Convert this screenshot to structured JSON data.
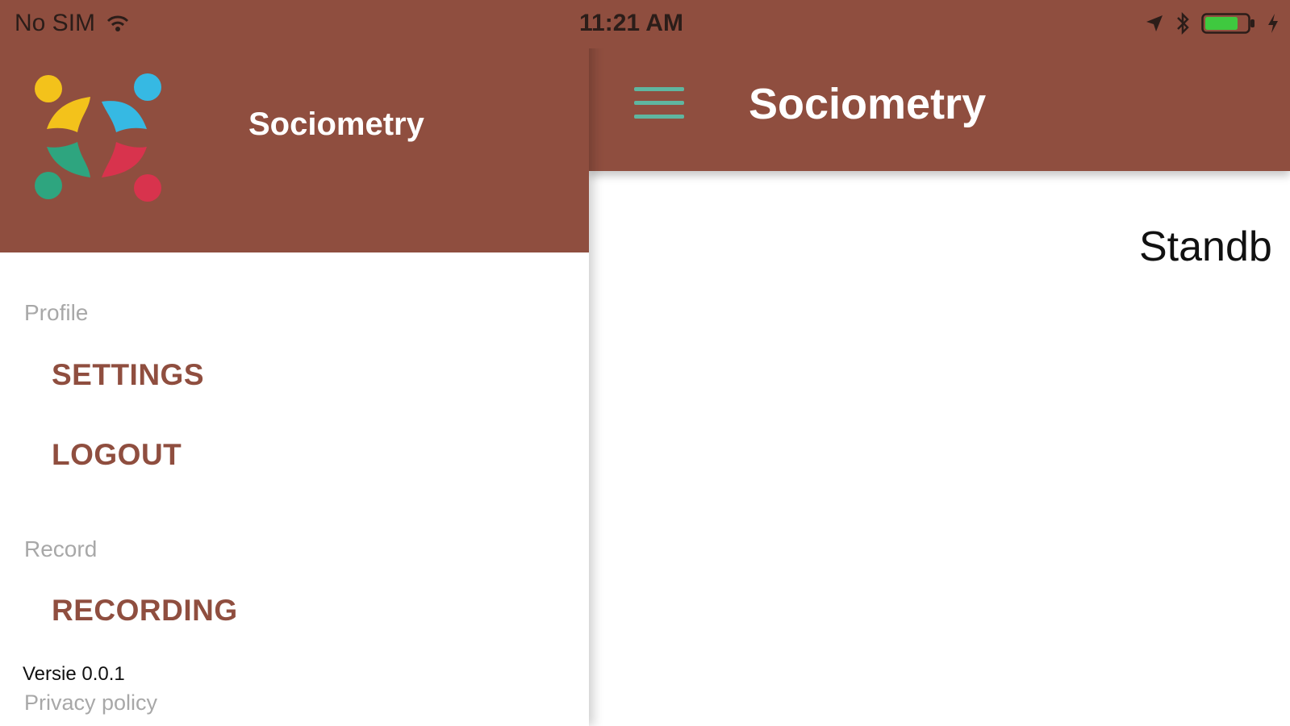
{
  "status_bar": {
    "carrier": "No SIM",
    "time": "11:21 AM",
    "icons": [
      "wifi-icon",
      "location-arrow-icon",
      "bluetooth-icon",
      "battery-icon",
      "charging-bolt-icon"
    ]
  },
  "drawer": {
    "app_name": "Sociometry",
    "logo": "sociometry-people-logo",
    "sections": [
      {
        "label": "Profile",
        "items": [
          "SETTINGS",
          "LOGOUT"
        ]
      },
      {
        "label": "Record",
        "items": [
          "RECORDING"
        ]
      }
    ],
    "version": "Versie 0.0.1",
    "privacy_link": "Privacy policy"
  },
  "main": {
    "title": "Sociometry",
    "menu_icon": "hamburger-menu-icon",
    "status_text": "Standb"
  },
  "colors": {
    "brand_brown": "#8f4e3f",
    "menu_icon_teal": "#5fb6a0",
    "battery_green": "#3fc93f",
    "logo_yellow": "#f3c21b",
    "logo_blue": "#36b9e3",
    "logo_green": "#2ea57f",
    "logo_red": "#d8334d"
  }
}
